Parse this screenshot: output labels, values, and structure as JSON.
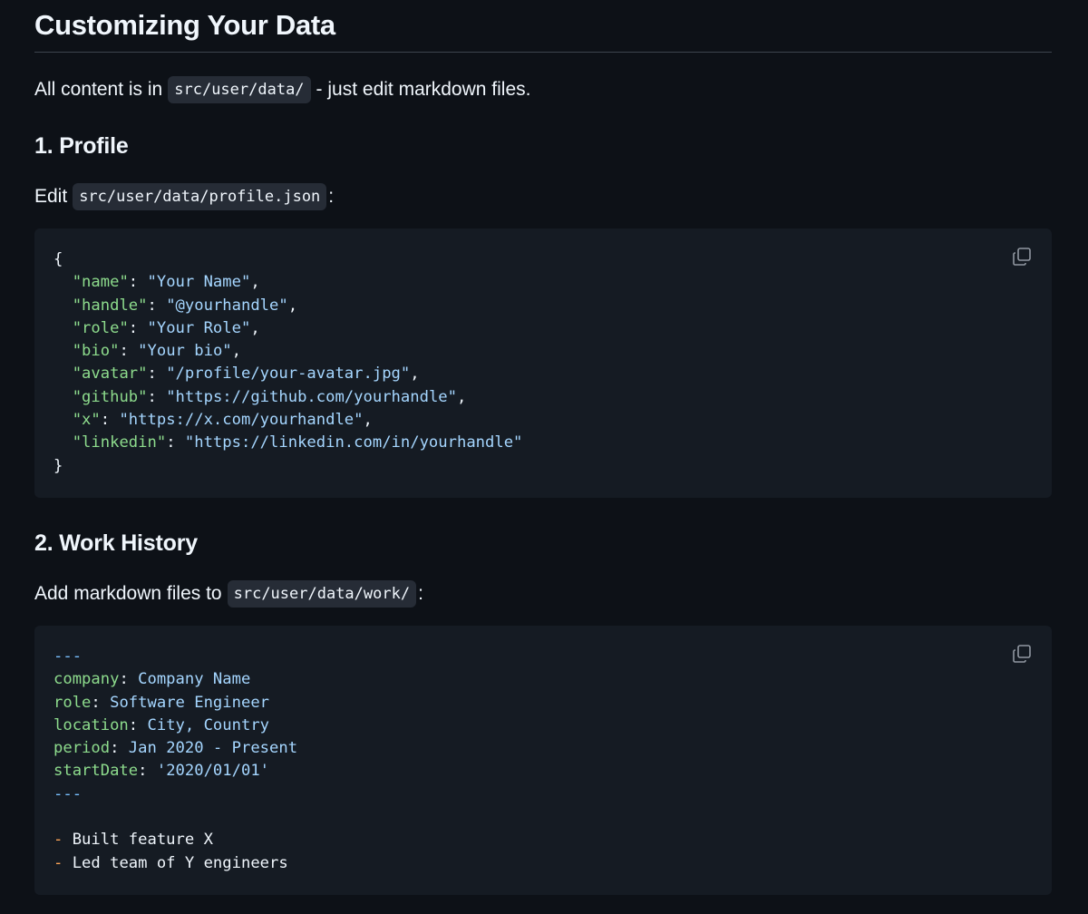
{
  "heading": "Customizing Your Data",
  "intro": {
    "before": "All content is in",
    "code": "src/user/data/",
    "after": "- just edit markdown files."
  },
  "sections": [
    {
      "title": "1. Profile",
      "lead_before": "Edit",
      "lead_code": "src/user/data/profile.json",
      "lead_after": ":",
      "code_lines": [
        [
          {
            "t": "{",
            "c": "pun"
          }
        ],
        [
          {
            "t": "  ",
            "c": "pun"
          },
          {
            "t": "\"name\"",
            "c": "key"
          },
          {
            "t": ": ",
            "c": "pun"
          },
          {
            "t": "\"Your Name\"",
            "c": "str"
          },
          {
            "t": ",",
            "c": "pun"
          }
        ],
        [
          {
            "t": "  ",
            "c": "pun"
          },
          {
            "t": "\"handle\"",
            "c": "key"
          },
          {
            "t": ": ",
            "c": "pun"
          },
          {
            "t": "\"@yourhandle\"",
            "c": "str"
          },
          {
            "t": ",",
            "c": "pun"
          }
        ],
        [
          {
            "t": "  ",
            "c": "pun"
          },
          {
            "t": "\"role\"",
            "c": "key"
          },
          {
            "t": ": ",
            "c": "pun"
          },
          {
            "t": "\"Your Role\"",
            "c": "str"
          },
          {
            "t": ",",
            "c": "pun"
          }
        ],
        [
          {
            "t": "  ",
            "c": "pun"
          },
          {
            "t": "\"bio\"",
            "c": "key"
          },
          {
            "t": ": ",
            "c": "pun"
          },
          {
            "t": "\"Your bio\"",
            "c": "str"
          },
          {
            "t": ",",
            "c": "pun"
          }
        ],
        [
          {
            "t": "  ",
            "c": "pun"
          },
          {
            "t": "\"avatar\"",
            "c": "key"
          },
          {
            "t": ": ",
            "c": "pun"
          },
          {
            "t": "\"/profile/your-avatar.jpg\"",
            "c": "str"
          },
          {
            "t": ",",
            "c": "pun"
          }
        ],
        [
          {
            "t": "  ",
            "c": "pun"
          },
          {
            "t": "\"github\"",
            "c": "key"
          },
          {
            "t": ": ",
            "c": "pun"
          },
          {
            "t": "\"https://github.com/yourhandle\"",
            "c": "str"
          },
          {
            "t": ",",
            "c": "pun"
          }
        ],
        [
          {
            "t": "  ",
            "c": "pun"
          },
          {
            "t": "\"x\"",
            "c": "key"
          },
          {
            "t": ": ",
            "c": "pun"
          },
          {
            "t": "\"https://x.com/yourhandle\"",
            "c": "str"
          },
          {
            "t": ",",
            "c": "pun"
          }
        ],
        [
          {
            "t": "  ",
            "c": "pun"
          },
          {
            "t": "\"linkedin\"",
            "c": "key"
          },
          {
            "t": ": ",
            "c": "pun"
          },
          {
            "t": "\"https://linkedin.com/in/yourhandle\"",
            "c": "str"
          }
        ],
        [
          {
            "t": "}",
            "c": "pun"
          }
        ]
      ]
    },
    {
      "title": "2. Work History",
      "lead_before": "Add markdown files to",
      "lead_code": "src/user/data/work/",
      "lead_after": ":",
      "code_lines": [
        [
          {
            "t": "---",
            "c": "sep"
          }
        ],
        [
          {
            "t": "company",
            "c": "key"
          },
          {
            "t": ": ",
            "c": "pun"
          },
          {
            "t": "Company Name",
            "c": "str"
          }
        ],
        [
          {
            "t": "role",
            "c": "key"
          },
          {
            "t": ": ",
            "c": "pun"
          },
          {
            "t": "Software Engineer",
            "c": "str"
          }
        ],
        [
          {
            "t": "location",
            "c": "key"
          },
          {
            "t": ": ",
            "c": "pun"
          },
          {
            "t": "City, Country",
            "c": "str"
          }
        ],
        [
          {
            "t": "period",
            "c": "key"
          },
          {
            "t": ": ",
            "c": "pun"
          },
          {
            "t": "Jan 2020 - Present",
            "c": "str"
          }
        ],
        [
          {
            "t": "startDate",
            "c": "key"
          },
          {
            "t": ": ",
            "c": "pun"
          },
          {
            "t": "'2020/01/01'",
            "c": "str"
          }
        ],
        [
          {
            "t": "---",
            "c": "sep"
          }
        ],
        [],
        [
          {
            "t": "-",
            "c": "dash"
          },
          {
            "t": " Built feature X",
            "c": "pun"
          }
        ],
        [
          {
            "t": "-",
            "c": "dash"
          },
          {
            "t": " Led team of Y engineers",
            "c": "pun"
          }
        ]
      ]
    }
  ],
  "icons": {
    "copy": "copy-icon"
  },
  "colors": {
    "background": "#0d1117",
    "code_background": "#151b23",
    "inline_code_background": "#262c36",
    "key": "#8ddb8c",
    "string": "#a5d6ff",
    "list_marker": "#ffa657",
    "separator": "#79c0ff"
  }
}
